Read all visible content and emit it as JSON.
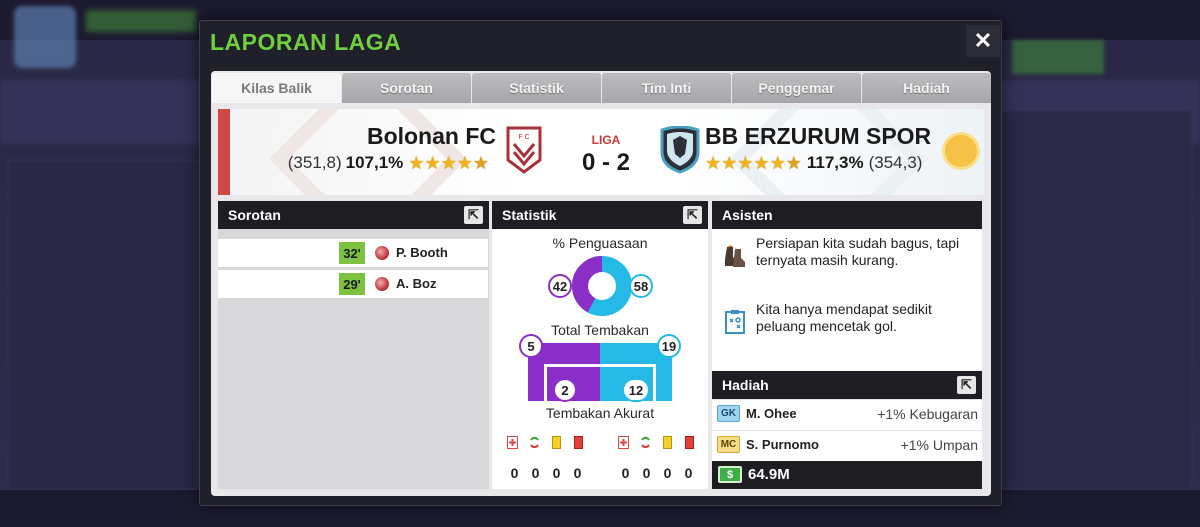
{
  "modal": {
    "title": "LAPORAN LAGA",
    "close_label": "✕"
  },
  "tabs": [
    {
      "label": "Kilas Balik",
      "active": true
    },
    {
      "label": "Sorotan",
      "active": false
    },
    {
      "label": "Statistik",
      "active": false
    },
    {
      "label": "Tim Inti",
      "active": false
    },
    {
      "label": "Penggemar",
      "active": false
    },
    {
      "label": "Hadiah",
      "active": false
    }
  ],
  "match": {
    "competition": "LIGA",
    "score": "0 - 2",
    "home": {
      "name": "Bolonan FC",
      "points": "(351,8)",
      "percent": "107,1%",
      "stars": 4.5,
      "crest_color": "#a8323a"
    },
    "away": {
      "name": "BB ERZURUM SPOR",
      "points": "(354,3)",
      "percent": "117,3%",
      "stars": 5.5,
      "crest_color": "#4a9fc2"
    },
    "weather_icon": "sun-icon"
  },
  "highlights": {
    "title": "Sorotan",
    "goals": [
      {
        "minute": "32'",
        "scorer": "P. Booth"
      },
      {
        "minute": "29'",
        "scorer": "A. Boz"
      }
    ]
  },
  "stats": {
    "title": "Statistik",
    "possession_label": "% Penguasaan",
    "possession_home": "42",
    "possession_away": "58",
    "shots_label": "Total Tembakan",
    "shots_home": "5",
    "shots_away": "19",
    "on_target_label": "Tembakan Akurat",
    "on_target_home": "2",
    "on_target_away": "12",
    "home_cards": [
      "0",
      "0",
      "0",
      "0"
    ],
    "away_cards": [
      "0",
      "0",
      "0",
      "0"
    ],
    "colors": {
      "home": "#8a2fc7",
      "away": "#25b9e6"
    }
  },
  "assistant": {
    "title": "Asisten",
    "messages": [
      {
        "icon": "boots-icon",
        "text": "Persiapan kita sudah bagus, tapi ternyata masih kurang."
      },
      {
        "icon": "tactics-board-icon",
        "text": "Kita hanya mendapat sedikit peluang mencetak gol."
      }
    ]
  },
  "rewards": {
    "title": "Hadiah",
    "items": [
      {
        "position": "GK",
        "name": "M. Ohee",
        "value": "+1% Kebugaran"
      },
      {
        "position": "MC",
        "name": "S. Purnomo",
        "value": "+1% Umpan"
      }
    ],
    "money": "64.9M"
  }
}
